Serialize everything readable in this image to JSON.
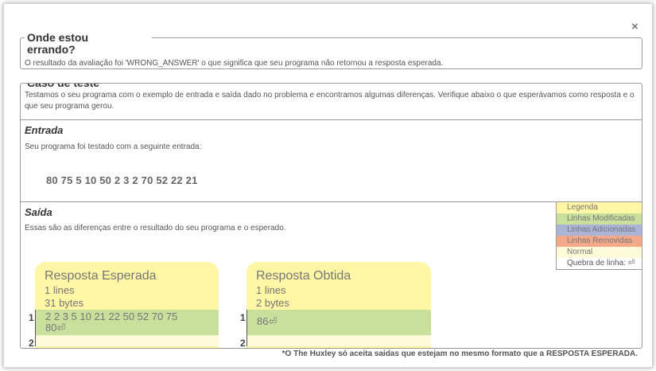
{
  "close": {
    "symbol": "×"
  },
  "where_wrong": {
    "title_line1": "Onde estou",
    "title_line2": "errando?",
    "text": "O resultado da avaliação foi 'WRONG_ANSWER' o que significa que seu programa não retornou a resposta esperada."
  },
  "test_case": {
    "title": "Caso de teste",
    "description": "Testamos o seu programa com o exemplo de entrada e saída dado no problema e encontramos algumas diferenças. Verifique abaixo o que esperávamos como resposta e o que seu programa gerou."
  },
  "input": {
    "title": "Entrada",
    "text": "Seu programa foi testado com a seguinte entrada:",
    "values": "80 75 5 10 50 2 3 2 70 52 22 21"
  },
  "output": {
    "title": "Saída",
    "text": "Essas são as diferenças entre o resultado do seu programa e o esperado."
  },
  "legend": {
    "title": "Legenda",
    "modified": "Linhas Modificadas",
    "added": "Linhas Adicionadas",
    "removed": "Linhas Removidas",
    "normal": "Normal",
    "line_break": "Quebra de linha: ⏎",
    "colors": {
      "title": "#fff6a6",
      "modified": "#c9df9c",
      "added": "#a9b4d6",
      "removed": "#f3a98a",
      "normal": "#fffbd9",
      "line_break": "#ffffff"
    }
  },
  "expected": {
    "title": "Resposta Esperada",
    "lines": "1 lines",
    "bytes": "31 bytes",
    "line1_num": "1",
    "line1_text_a": "2 2 3 5 10 21 22 50 52 70 75",
    "line1_text_b": "80⏎",
    "line2_num": "2"
  },
  "obtained": {
    "title": "Resposta Obtida",
    "lines": "1 lines",
    "bytes": "2 bytes",
    "line1_num": "1",
    "line1_text": "86⏎",
    "line2_num": "2"
  },
  "footnote": "*O The Huxley só aceita saídas que estejam no mesmo formato que a RESPOSTA ESPERADA."
}
